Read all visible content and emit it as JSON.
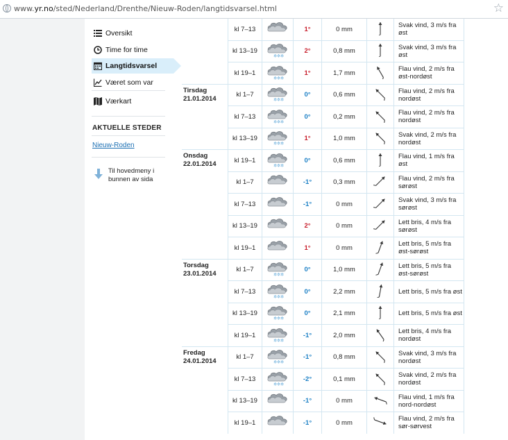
{
  "browser": {
    "url_prefix": "www.",
    "url_host": "yr.no",
    "url_path": "/sted/Nederland/Drenthe/Nieuw-Roden/langtidsvarsel.html"
  },
  "sidebar": {
    "items": [
      {
        "label": "Oversikt",
        "icon": "list-icon"
      },
      {
        "label": "Time for time",
        "icon": "clock-icon"
      },
      {
        "label": "Langtidsvarsel",
        "icon": "calendar-icon",
        "active": true
      },
      {
        "label": "Været som var",
        "icon": "chart-icon"
      },
      {
        "label": "Værkart",
        "icon": "map-icon"
      }
    ],
    "current_places_heading": "AKTUELLE STEDER",
    "current_place": "Nieuw-Roden",
    "main_menu_link": "Til hovedmeny i bunnen av sida"
  },
  "forecast": {
    "days": [
      {
        "day": "",
        "date": "",
        "rows": [
          {
            "time": "kl 7–13",
            "temp": "1°",
            "temp_class": "warm",
            "precip": "0 mm",
            "wind": "Svak vind, 3 m/s fra øst",
            "snow": false,
            "dir": 270
          },
          {
            "time": "kl 13–19",
            "temp": "2°",
            "temp_class": "warm",
            "precip": "0,8 mm",
            "wind": "Svak vind, 3 m/s fra øst",
            "snow": true,
            "dir": 270
          },
          {
            "time": "kl 19–1",
            "temp": "1°",
            "temp_class": "warm",
            "precip": "1,7 mm",
            "wind": "Flau vind, 2 m/s fra øst-nordøst",
            "snow": true,
            "dir": 240
          }
        ]
      },
      {
        "day": "Tirsdag",
        "date": "21.01.2014",
        "rows": [
          {
            "time": "kl 1–7",
            "temp": "0°",
            "temp_class": "cold",
            "precip": "0,6 mm",
            "wind": "Flau vind, 2 m/s fra nordøst",
            "snow": true,
            "dir": 225
          },
          {
            "time": "kl 7–13",
            "temp": "0°",
            "temp_class": "cold",
            "precip": "0,2 mm",
            "wind": "Flau vind, 2 m/s fra nordøst",
            "snow": true,
            "dir": 225
          },
          {
            "time": "kl 13–19",
            "temp": "1°",
            "temp_class": "warm",
            "precip": "1,0 mm",
            "wind": "Svak vind, 2 m/s fra nordøst",
            "snow": true,
            "dir": 225
          }
        ]
      },
      {
        "day": "Onsdag",
        "date": "22.01.2014",
        "rows": [
          {
            "time": "kl 19–1",
            "temp": "0°",
            "temp_class": "cold",
            "precip": "0,6 mm",
            "wind": "Flau vind, 1 m/s fra øst",
            "snow": true,
            "dir": 270
          },
          {
            "time": "kl 1–7",
            "temp": "-1°",
            "temp_class": "cold",
            "precip": "0,3 mm",
            "wind": "Flau vind, 2 m/s fra sørøst",
            "snow": false,
            "dir": 315
          },
          {
            "time": "kl 7–13",
            "temp": "-1°",
            "temp_class": "cold",
            "precip": "0 mm",
            "wind": "Svak vind, 3 m/s fra sørøst",
            "snow": false,
            "dir": 315
          },
          {
            "time": "kl 13–19",
            "temp": "2°",
            "temp_class": "warm",
            "precip": "0 mm",
            "wind": "Lett bris, 4 m/s fra sørøst",
            "snow": false,
            "dir": 315
          },
          {
            "time": "kl 19–1",
            "temp": "1°",
            "temp_class": "warm",
            "precip": "0 mm",
            "wind": "Lett bris, 5 m/s fra øst-sørøst",
            "snow": false,
            "dir": 290
          }
        ]
      },
      {
        "day": "Torsdag",
        "date": "23.01.2014",
        "rows": [
          {
            "time": "kl 1–7",
            "temp": "0°",
            "temp_class": "cold",
            "precip": "1,0 mm",
            "wind": "Lett bris, 5 m/s fra øst-sørøst",
            "snow": true,
            "dir": 290
          },
          {
            "time": "kl 7–13",
            "temp": "0°",
            "temp_class": "cold",
            "precip": "2,2 mm",
            "wind": "Lett bris, 5 m/s fra øst",
            "snow": true,
            "dir": 280
          },
          {
            "time": "kl 13–19",
            "temp": "0°",
            "temp_class": "cold",
            "precip": "2,1 mm",
            "wind": "Lett bris, 5 m/s fra øst",
            "snow": true,
            "dir": 270
          },
          {
            "time": "kl 19–1",
            "temp": "-1°",
            "temp_class": "cold",
            "precip": "2,0 mm",
            "wind": "Lett bris, 4 m/s fra nordøst",
            "snow": true,
            "dir": 235
          }
        ]
      },
      {
        "day": "Fredag",
        "date": "24.01.2014",
        "rows": [
          {
            "time": "kl 1–7",
            "temp": "-1°",
            "temp_class": "cold",
            "precip": "0,8 mm",
            "wind": "Svak vind, 3 m/s fra nordøst",
            "snow": true,
            "dir": 225
          },
          {
            "time": "kl 7–13",
            "temp": "-2°",
            "temp_class": "cold",
            "precip": "0,1 mm",
            "wind": "Svak vind, 2 m/s fra nordøst",
            "snow": true,
            "dir": 225
          },
          {
            "time": "kl 13–19",
            "temp": "-1°",
            "temp_class": "cold",
            "precip": "0 mm",
            "wind": "Flau vind, 1 m/s fra nord-nordøst",
            "snow": false,
            "dir": 200
          },
          {
            "time": "kl 19–1",
            "temp": "-1°",
            "temp_class": "cold",
            "precip": "0 mm",
            "wind": "Flau vind, 2 m/s fra sør-sørvest",
            "snow": false,
            "dir": 20
          }
        ]
      }
    ]
  },
  "colors": {
    "warm": "#c8202d",
    "cold": "#1b7fc5",
    "link": "#1b6fb3",
    "active_bg": "#d9eefa",
    "grid": "#d3e6f1"
  }
}
